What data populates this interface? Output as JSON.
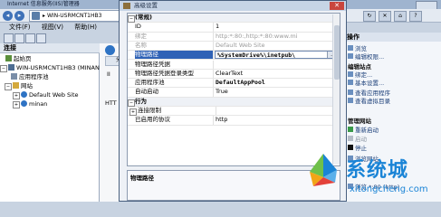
{
  "background_window": {
    "title": "Internet 信息服务(IIS)管理器",
    "address": "WIN-USRMCNT1HB3",
    "address_sep": "▸",
    "menu": [
      "文件(F)",
      "视图(V)",
      "帮助(H)"
    ],
    "connections_title": "连接",
    "tree": [
      {
        "label": "起始页",
        "icon": "home-icon",
        "indent": 0
      },
      {
        "label": "WIN-USRMCNT1HB3 (MINAN",
        "icon": "server-icon",
        "indent": 0
      },
      {
        "label": "应用程序池",
        "icon": "app-pool-icon",
        "indent": 1
      },
      {
        "label": "网站",
        "icon": "sites-folder-icon",
        "indent": 1
      },
      {
        "label": "Default Web Site",
        "icon": "globe-icon",
        "indent": 2
      },
      {
        "label": "minan",
        "icon": "globe-icon",
        "indent": 2
      }
    ],
    "center_tab": "分",
    "center_fragments": [
      "II",
      "HTT"
    ],
    "actions_title": "操作",
    "actions": [
      {
        "label": "浏览",
        "icon": "browse-icon"
      },
      {
        "label": "编辑权限...",
        "icon": "edit-icon"
      },
      {
        "group": "编辑站点"
      },
      {
        "label": "绑定...",
        "icon": "link-icon"
      },
      {
        "label": "基本设置...",
        "icon": "settings-icon"
      },
      {
        "label": "查看应用程序",
        "icon": "app-icon"
      },
      {
        "label": "查看虚拟目录",
        "icon": "folder-icon"
      },
      {
        "group": "管理网站"
      },
      {
        "label": "重新启动",
        "icon": "restart-icon"
      },
      {
        "label": "启动",
        "icon": "start-icon",
        "disabled": true
      },
      {
        "label": "停止",
        "icon": "stop-icon"
      },
      {
        "label": "浏览网站",
        "icon": "browse-icon"
      },
      {
        "label": "浏览 *:80 (http)",
        "icon": "browse-icon"
      }
    ]
  },
  "dialog": {
    "title": "高级设置",
    "close": "✕",
    "rows": [
      {
        "type": "cat",
        "name": "(常规)",
        "toggle": "−"
      },
      {
        "type": "prop",
        "name": "ID",
        "value": "1"
      },
      {
        "type": "prop",
        "name": "绑定",
        "value": "http:*:80:,http:*:80:www.mi",
        "dim": true
      },
      {
        "type": "prop",
        "name": "名称",
        "value": "Default Web Site",
        "dim": true
      },
      {
        "type": "prop",
        "name": "物理路径",
        "value": "%SystemDrive%\\inetpub\\",
        "selected": true,
        "button": "..."
      },
      {
        "type": "prop",
        "name": "物理路径凭据",
        "value": ""
      },
      {
        "type": "prop",
        "name": "物理路径凭据登录类型",
        "value": "ClearText"
      },
      {
        "type": "prop",
        "name": "应用程序池",
        "value": "DefaultAppPool",
        "bold": true
      },
      {
        "type": "prop",
        "name": "自动启动",
        "value": "True"
      },
      {
        "type": "cat",
        "name": "行为",
        "toggle": "−"
      },
      {
        "type": "cat",
        "name": "连接限制",
        "toggle": "+"
      },
      {
        "type": "prop",
        "name": "已启用的协议",
        "value": "http"
      }
    ],
    "description_title": "物理路径"
  },
  "watermark": {
    "cn": "系统城",
    "en": "xitongcheng.com"
  },
  "colors": {
    "selection": "#2f62b6",
    "watermark": "#1a84d6",
    "titlebar": "#9fb4cf"
  }
}
